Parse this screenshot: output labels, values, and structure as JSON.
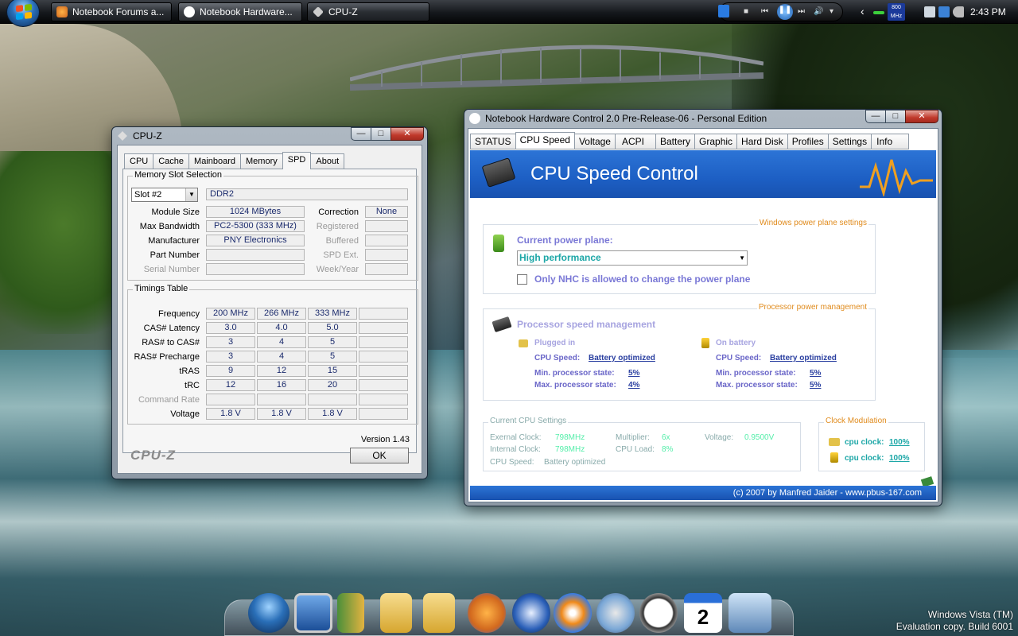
{
  "taskbar": {
    "windows": [
      {
        "label": "Notebook Forums a..."
      },
      {
        "label": "Notebook Hardware..."
      },
      {
        "label": "CPU-Z"
      }
    ],
    "clock": "2:43 PM",
    "tray_speed_badge": "800 MHz"
  },
  "cpuz": {
    "title": "CPU-Z",
    "tabs": [
      "CPU",
      "Cache",
      "Mainboard",
      "Memory",
      "SPD",
      "About"
    ],
    "selected_tab": "SPD",
    "memory_slot": {
      "group_title": "Memory Slot Selection",
      "slot": "Slot #2",
      "type": "DDR2",
      "module_size_label": "Module Size",
      "module_size": "1024 MBytes",
      "max_bandwidth_label": "Max Bandwidth",
      "max_bandwidth": "PC2-5300 (333 MHz)",
      "manufacturer_label": "Manufacturer",
      "manufacturer": "PNY Electronics",
      "part_number_label": "Part Number",
      "part_number": "",
      "serial_number_label": "Serial Number",
      "correction_label": "Correction",
      "correction": "None",
      "registered_label": "Registered",
      "buffered_label": "Buffered",
      "spd_ext_label": "SPD Ext.",
      "week_year_label": "Week/Year"
    },
    "timings": {
      "group_title": "Timings Table",
      "rows": [
        {
          "label": "Frequency",
          "v": [
            "200 MHz",
            "266 MHz",
            "333 MHz",
            ""
          ]
        },
        {
          "label": "CAS# Latency",
          "v": [
            "3.0",
            "4.0",
            "5.0",
            ""
          ]
        },
        {
          "label": "RAS# to CAS#",
          "v": [
            "3",
            "4",
            "5",
            ""
          ]
        },
        {
          "label": "RAS# Precharge",
          "v": [
            "3",
            "4",
            "5",
            ""
          ]
        },
        {
          "label": "tRAS",
          "v": [
            "9",
            "12",
            "15",
            ""
          ]
        },
        {
          "label": "tRC",
          "v": [
            "12",
            "16",
            "20",
            ""
          ]
        },
        {
          "label": "Command Rate",
          "v": [
            "",
            "",
            "",
            ""
          ]
        },
        {
          "label": "Voltage",
          "v": [
            "1.8 V",
            "1.8 V",
            "1.8 V",
            ""
          ]
        }
      ]
    },
    "version": "Version 1.43",
    "logo": "CPU-Z",
    "ok_label": "OK"
  },
  "nhc": {
    "title": "Notebook Hardware Control 2.0 Pre-Release-06  -  Personal Edition",
    "tabs": [
      "STATUS",
      "CPU Speed",
      "Voltage",
      "ACPI",
      "Battery",
      "Graphic",
      "Hard Disk",
      "Profiles",
      "Settings",
      "Info"
    ],
    "selected_tab": "CPU Speed",
    "banner_title": "CPU Speed Control",
    "power_plane": {
      "section_title": "Windows power plane settings",
      "label": "Current power plane:",
      "value": "High performance",
      "checkbox_label": "Only NHC is allowed to change the power plane"
    },
    "processor": {
      "section_title": "Processor power management",
      "heading": "Processor speed management",
      "plugged": {
        "title": "Plugged in",
        "cpu_speed_label": "CPU Speed:",
        "cpu_speed": "Battery optimized",
        "min_label": "Min. processor state:",
        "min": "5%",
        "max_label": "Max. processor state:",
        "max": "4%"
      },
      "battery": {
        "title": "On battery",
        "cpu_speed_label": "CPU Speed:",
        "cpu_speed": "Battery optimized",
        "min_label": "Min.  processor state:",
        "min": "5%",
        "max_label": "Max. processor state:",
        "max": "5%"
      }
    },
    "current": {
      "section_title": "Current CPU Settings",
      "ext_clock_label": "Exernal Clock:",
      "ext_clock": "798MHz",
      "int_clock_label": "Internal Clock:",
      "int_clock": "798MHz",
      "multiplier_label": "Multiplier:",
      "multiplier": "6x",
      "cpu_load_label": "CPU Load:",
      "cpu_load": "8%",
      "voltage_label": "Voltage:",
      "voltage": "0.9500V",
      "cpu_speed_label": "CPU Speed:",
      "cpu_speed": "Battery optimized"
    },
    "clock_mod": {
      "section_title": "Clock Modulation",
      "label": "cpu clock:",
      "plugged": "100%",
      "battery": "100%"
    },
    "footer": "(c) 2007 by Manfred Jaider - www.pbus-167.com"
  },
  "watermark": {
    "line1": "Windows Vista (TM)",
    "line2": "Evaluation copy. Build 6001"
  },
  "colors": {
    "nhc_banner": "#1d5fc4",
    "nhc_orange": "#e08b1d",
    "nhc_accent_purple": "#7a78d6",
    "cpuz_value": "#1a2a6c"
  }
}
